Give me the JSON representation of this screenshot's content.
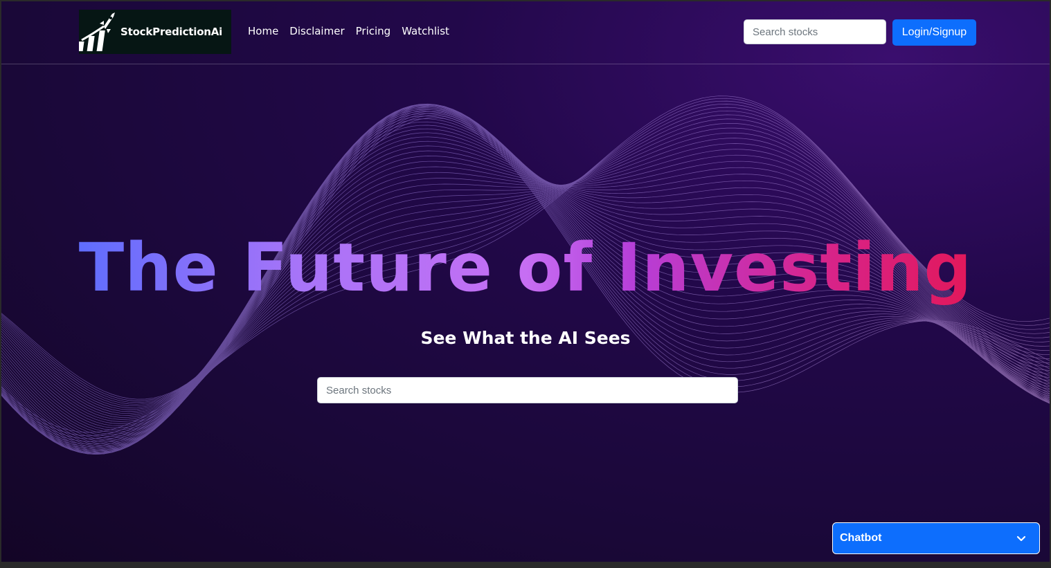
{
  "brand": {
    "name": "StockPredictionAi",
    "logo_icon": "rocket-chart-icon"
  },
  "nav": {
    "links": [
      "Home",
      "Disclaimer",
      "Pricing",
      "Watchlist"
    ],
    "search_placeholder": "Search stocks",
    "login_label": "Login/Signup"
  },
  "hero": {
    "title": "The Future of Investing",
    "subtitle": "See What the AI Sees",
    "search_placeholder": "Search stocks"
  },
  "chatbot": {
    "label": "Chatbot",
    "toggle_icon": "chevron-down-icon"
  },
  "colors": {
    "accent": "#0d6efd",
    "background": "#1a0838",
    "gradient_start": "#5f6dfd",
    "gradient_end": "#e2185a"
  }
}
